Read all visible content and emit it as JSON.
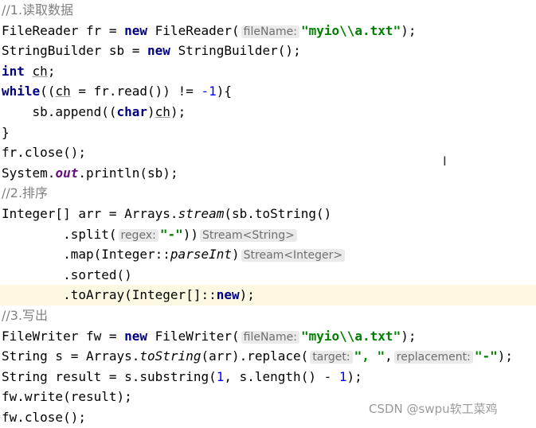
{
  "code": {
    "l1_comment": "//1.读取数据",
    "l2_type": "FileReader fr = ",
    "l2_new": "new",
    "l2_ctor": " FileReader(",
    "l2_hint": "fileName:",
    "l2_str": "\"myio\\\\a.txt\"",
    "l2_end": ");",
    "l3_type": "StringBuilder sb = ",
    "l3_new": "new",
    "l3_end": " StringBuilder();",
    "l4_int": "int",
    "l4_ch": "ch",
    "l4_end": ";",
    "l5_while": "while",
    "l5_a": "((",
    "l5_ch": "ch",
    "l5_b": " = fr.read()) != ",
    "l5_num": "-1",
    "l5_end": "){",
    "l6_indent": "    sb.append((",
    "l6_char": "char",
    "l6_close": ")",
    "l6_ch": "ch",
    "l6_end": ");",
    "l7": "}",
    "l8": "fr.close();",
    "l9_a": "System.",
    "l9_out": "out",
    "l9_b": ".println(sb);",
    "l10_comment": "//2.排序",
    "l11_a": "Integer[] arr = Arrays.",
    "l11_stream": "stream",
    "l11_b": "(sb.toString()",
    "l12_a": "        .split(",
    "l12_hint": "regex:",
    "l12_str": "\"-\"",
    "l12_b": "))",
    "l12_type": "Stream<String>",
    "l13_a": "        .map(Integer::",
    "l13_parse": "parseInt",
    "l13_b": ")",
    "l13_type": "Stream<Integer>",
    "l14": "        .sorted()",
    "l15_a": "        .toArray(Integer[]::",
    "l15_new": "new",
    "l15_b": ");",
    "l16_comment": "//3.写出",
    "l17_type": "FileWriter fw = ",
    "l17_new": "new",
    "l17_ctor": " FileWriter(",
    "l17_hint": "fileName:",
    "l17_str": "\"myio\\\\a.txt\"",
    "l17_end": ");",
    "l18_a": "String s = Arrays.",
    "l18_tostr": "toString",
    "l18_b": "(arr).replace(",
    "l18_hint1": "target:",
    "l18_str1": "\", \"",
    "l18_c": ",",
    "l18_hint2": "replacement:",
    "l18_str2": "\"-\"",
    "l18_end": ");",
    "l19_a": "String result = s.substring(",
    "l19_n1": "1",
    "l19_b": ", s.length() - ",
    "l19_n2": "1",
    "l19_end": ");",
    "l20": "fw.write(result);",
    "l21": "fw.close();"
  },
  "cursor_glyph": "I",
  "watermark": "CSDN @swpu软工菜鸡"
}
